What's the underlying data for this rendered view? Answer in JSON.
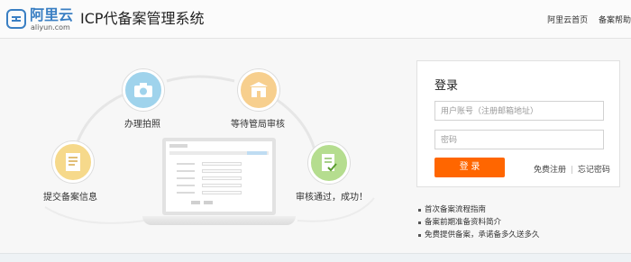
{
  "header": {
    "logo_cn": "阿里云",
    "logo_en": "aliyun.com",
    "title": "ICP代备案管理系统",
    "nav": [
      "阿里云首页",
      "备案帮助"
    ]
  },
  "steps": [
    {
      "label": "提交备案信息",
      "icon": "document-icon",
      "color": "#f6d98b"
    },
    {
      "label": "办理拍照",
      "icon": "camera-icon",
      "color": "#9fd3ec"
    },
    {
      "label": "等待管局审核",
      "icon": "building-icon",
      "color": "#f7cf8e"
    },
    {
      "label": "审核通过，成功！",
      "icon": "check-document-icon",
      "color": "#b5dd8f"
    }
  ],
  "login": {
    "title": "登录",
    "account_placeholder": "用户账号（注册邮箱地址）",
    "password_placeholder": "密码",
    "submit_label": "登 录",
    "register_link": "免费注册",
    "forgot_link": "忘记密码",
    "separator": "|"
  },
  "guide_links": [
    "首次备案流程指南",
    "备案前期准备资料简介",
    "免费提供备案，承诺备多久送多久"
  ],
  "colors": {
    "accent": "#ff6600",
    "brand": "#3a7fc3"
  }
}
